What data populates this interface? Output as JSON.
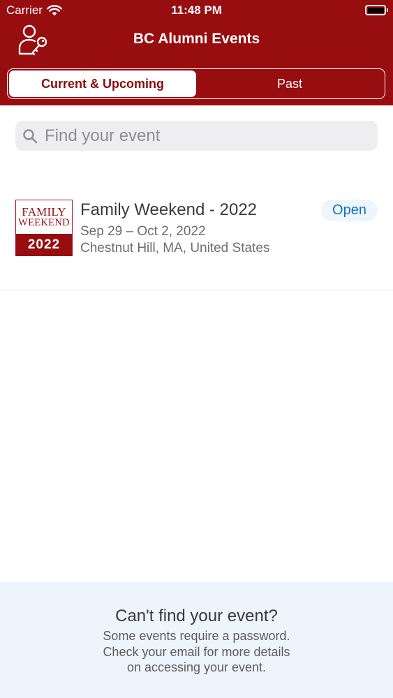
{
  "status_bar": {
    "carrier": "Carrier",
    "time": "11:48 PM",
    "wifi_icon": "wifi-icon",
    "battery_icon": "battery-icon"
  },
  "nav": {
    "title": "BC Alumni Events",
    "left_icon": "profile-key-icon"
  },
  "tabs": [
    {
      "label": "Current & Upcoming",
      "selected": true
    },
    {
      "label": "Past",
      "selected": false
    }
  ],
  "search": {
    "placeholder": "Find your event",
    "icon": "search-icon"
  },
  "events": [
    {
      "thumbnail": {
        "line1": "FAMILY",
        "line2": "WEEKEND",
        "year": "2022"
      },
      "title": "Family Weekend - 2022",
      "dates": "Sep 29 – Oct 2, 2022",
      "location": "Chestnut Hill, MA, United States",
      "status": "Open"
    }
  ],
  "footer": {
    "title": "Can't find your event?",
    "line1": "Some events require a password.",
    "line2": "Check your email for more details",
    "line3": "on accessing your event."
  },
  "colors": {
    "brand": "#980d0f",
    "status_open": "#0a73c9",
    "footer_bg": "#eef4fc"
  }
}
